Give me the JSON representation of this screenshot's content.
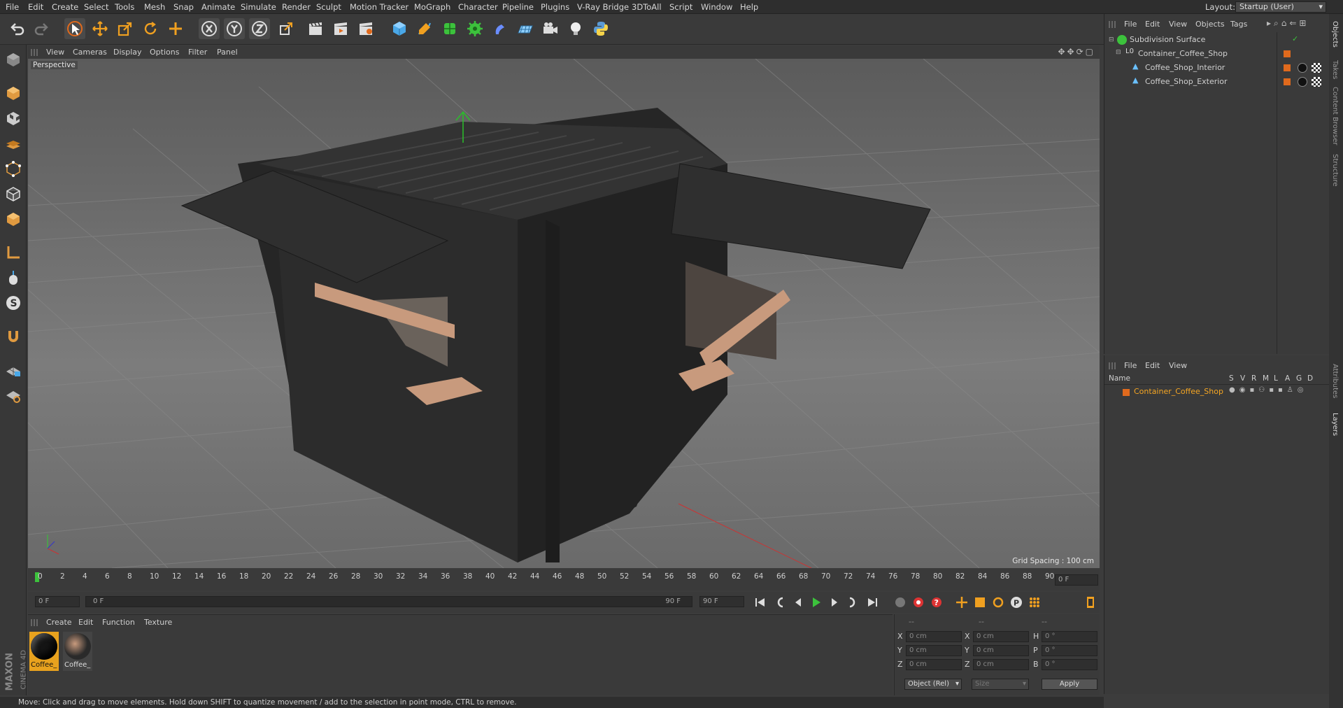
{
  "menu": [
    "File",
    "Edit",
    "Create",
    "Select",
    "Tools",
    "Mesh",
    "Snap",
    "Animate",
    "Simulate",
    "Render",
    "Sculpt",
    "Motion Tracker",
    "MoGraph",
    "Character",
    "Pipeline",
    "Plugins",
    "V-Ray Bridge",
    "3DToAll",
    "Script",
    "Window",
    "Help"
  ],
  "layout": {
    "label": "Layout:",
    "value": "Startup (User)"
  },
  "viewport": {
    "menu": [
      "View",
      "Cameras",
      "Display",
      "Options",
      "Filter",
      "Panel"
    ],
    "camera": "Perspective",
    "grid_spacing": "Grid Spacing : 100 cm"
  },
  "timeline": {
    "ticks": [
      "0",
      "2",
      "4",
      "6",
      "8",
      "10",
      "12",
      "14",
      "16",
      "18",
      "20",
      "22",
      "24",
      "26",
      "28",
      "30",
      "32",
      "34",
      "36",
      "38",
      "40",
      "42",
      "44",
      "46",
      "48",
      "50",
      "52",
      "54",
      "56",
      "58",
      "60",
      "62",
      "64",
      "66",
      "68",
      "70",
      "72",
      "74",
      "76",
      "78",
      "80",
      "82",
      "84",
      "86",
      "88",
      "90"
    ],
    "frame_end_field": "0 F"
  },
  "playbar": {
    "current": "0 F",
    "range_start": "0 F",
    "range_end": "90 F",
    "max": "90 F"
  },
  "materials": {
    "menu": [
      "Create",
      "Edit",
      "Function",
      "Texture"
    ],
    "items": [
      {
        "label": "Coffee_"
      },
      {
        "label": "Coffee_"
      }
    ]
  },
  "coords": {
    "header": [
      "--",
      "--",
      "--"
    ],
    "rows": [
      {
        "a": "X",
        "av": "0 cm",
        "b": "X",
        "bv": "0 cm",
        "c": "H",
        "cv": "0 °"
      },
      {
        "a": "Y",
        "av": "0 cm",
        "b": "Y",
        "bv": "0 cm",
        "c": "P",
        "cv": "0 °"
      },
      {
        "a": "Z",
        "av": "0 cm",
        "b": "Z",
        "bv": "0 cm",
        "c": "B",
        "cv": "0 °"
      }
    ],
    "mode": "Object (Rel)",
    "size": "Size",
    "apply": "Apply"
  },
  "objects": {
    "menu": [
      "File",
      "Edit",
      "View",
      "Objects",
      "Tags"
    ],
    "tree": [
      {
        "name": "Subdivision Surface"
      },
      {
        "name": "Container_Coffee_Shop"
      },
      {
        "name": "Coffee_Shop_Interior"
      },
      {
        "name": "Coffee_Shop_Exterior"
      }
    ]
  },
  "layers": {
    "menu": [
      "File",
      "Edit",
      "View"
    ],
    "columns": [
      "Name",
      "S",
      "V",
      "R",
      "M",
      "L",
      "A",
      "G",
      "D"
    ],
    "row": "Container_Coffee_Shop"
  },
  "right_tabs": [
    "Objects",
    "Takes",
    "Content Browser",
    "Structure",
    "Attributes",
    "Layers"
  ],
  "status": "Move: Click and drag to move elements. Hold down SHIFT to quantize movement / add to the selection in point mode, CTRL to remove.",
  "brand": {
    "maxon": "MAXON",
    "product": "CINEMA 4D"
  },
  "colors": {
    "accent": "#e06a1d",
    "selected_text": "#f5a623",
    "play": "#3cc23c"
  }
}
